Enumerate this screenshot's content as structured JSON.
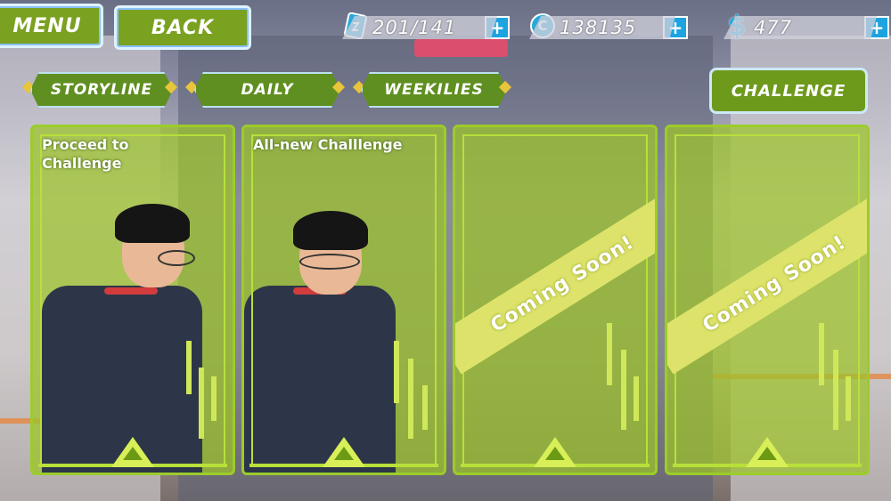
{
  "header": {
    "menu_label": "MENU",
    "back_label": "BACK"
  },
  "resources": [
    {
      "icon": "energy-card-icon",
      "value": "201/141",
      "plus": "+"
    },
    {
      "icon": "coin-icon",
      "icon_glyph": "C",
      "value": "138135",
      "plus": "+"
    },
    {
      "icon": "dollar-icon",
      "icon_glyph": "$",
      "value": "477",
      "plus": "+"
    }
  ],
  "tabs": [
    "STORYLINE",
    "DAILY",
    "WEEKILIES"
  ],
  "challenge_label": "CHALLENGE",
  "cards": [
    {
      "caption_line1": "Proceed to",
      "caption_line2": "Challenge",
      "banner": ""
    },
    {
      "caption_line1": "All-new Challlenge",
      "caption_line2": "",
      "banner": ""
    },
    {
      "caption_line1": "",
      "caption_line2": "",
      "banner": "Coming Soon!"
    },
    {
      "caption_line1": "",
      "caption_line2": "",
      "banner": "Coming Soon!"
    }
  ],
  "colors": {
    "accent_green": "#7aa11f",
    "plus_blue": "#1ca3e0",
    "diamond_gold": "#e8c53b"
  }
}
